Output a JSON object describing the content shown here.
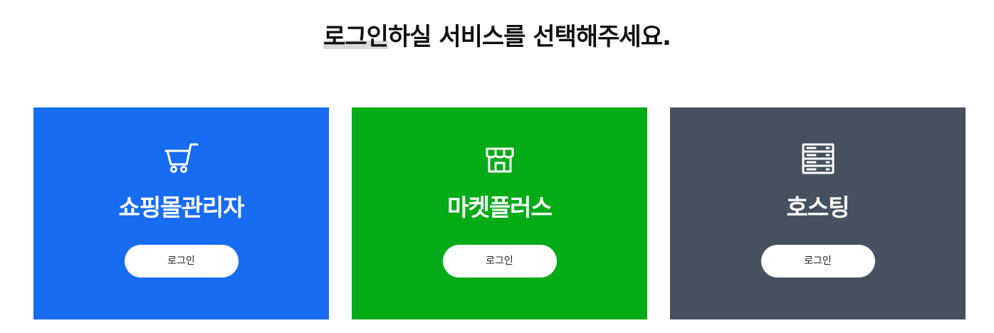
{
  "header": {
    "title_highlight": "로그인",
    "title_rest": "하실 서비스를 선택해주세요."
  },
  "cards": [
    {
      "title": "쇼핑몰관리자",
      "button_label": "로그인",
      "icon": "cart-icon",
      "color": "#186cf2"
    },
    {
      "title": "마켓플러스",
      "button_label": "로그인",
      "icon": "storefront-icon",
      "color": "#03ab17"
    },
    {
      "title": "호스팅",
      "button_label": "로그인",
      "icon": "server-icon",
      "color": "#46505e"
    }
  ]
}
